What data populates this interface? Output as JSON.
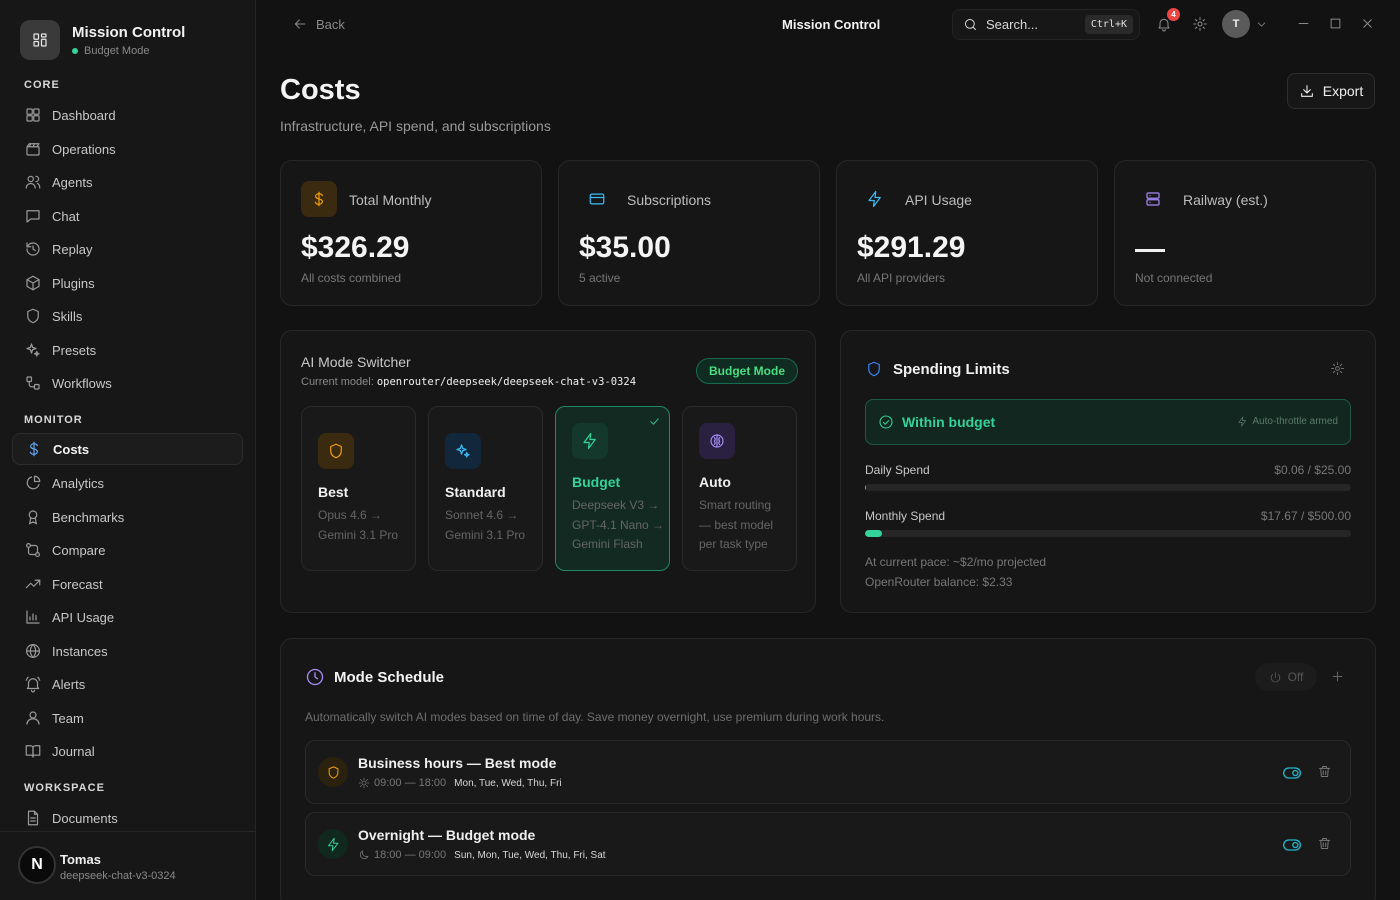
{
  "sidebar": {
    "brand_title": "Mission Control",
    "brand_mode": "Budget Mode",
    "sections": {
      "core": "CORE",
      "monitor": "MONITOR",
      "workspace": "WORKSPACE"
    },
    "core_items": [
      "Dashboard",
      "Operations",
      "Agents",
      "Chat",
      "Replay",
      "Plugins",
      "Skills",
      "Presets",
      "Workflows"
    ],
    "monitor_items": [
      "Costs",
      "Analytics",
      "Benchmarks",
      "Compare",
      "Forecast",
      "API Usage",
      "Instances",
      "Alerts",
      "Team",
      "Journal"
    ],
    "workspace_items": [
      "Documents"
    ],
    "active": "Costs",
    "user": {
      "initial": "N",
      "name": "Tomas",
      "model": "deepseek-chat-v3-0324"
    }
  },
  "topbar": {
    "back": "Back",
    "title": "Mission Control",
    "search_placeholder": "Search...",
    "search_shortcut": "Ctrl+K",
    "notifications": "4",
    "avatar_initial": "T"
  },
  "header": {
    "title": "Costs",
    "subtitle": "Infrastructure, API spend, and subscriptions",
    "export": "Export"
  },
  "stats": [
    {
      "label": "Total Monthly",
      "value": "$326.29",
      "note": "All costs combined",
      "icon": "dollar-icon",
      "color": "#f59e0b"
    },
    {
      "label": "Subscriptions",
      "value": "$35.00",
      "note": "5 active",
      "icon": "credit-card-icon",
      "color": "#38bdf8"
    },
    {
      "label": "API Usage",
      "value": "$291.29",
      "note": "All API providers",
      "icon": "lightning-icon",
      "color": "#38bdf8"
    },
    {
      "label": "Railway (est.)",
      "value": "",
      "note": "Not connected",
      "icon": "server-icon",
      "color": "#a78bfa"
    }
  ],
  "mode_switcher": {
    "title": "AI Mode Switcher",
    "current_label": "Current model:",
    "current_model": "openrouter/deepseek/deepseek-chat-v3-0324",
    "active_pill": "Budget Mode",
    "modes": [
      {
        "name": "Best",
        "desc": "Opus 4.6 → Gemini 3.1 Pro",
        "icon": "shield-icon",
        "color": "#f59e0b"
      },
      {
        "name": "Standard",
        "desc": "Sonnet 4.6 → Gemini 3.1 Pro",
        "icon": "sparkles-icon",
        "color": "#38bdf8"
      },
      {
        "name": "Budget",
        "desc": "Deepseek V3 → GPT-4.1 Nano → Gemini Flash",
        "icon": "lightning-icon",
        "color": "#34d399",
        "selected": true
      },
      {
        "name": "Auto",
        "desc": "Smart routing — best model per task type",
        "icon": "brain-icon",
        "color": "#a78bfa"
      }
    ]
  },
  "spending": {
    "title": "Spending Limits",
    "status": "Within budget",
    "throttle": "Auto-throttle armed",
    "daily": {
      "label": "Daily Spend",
      "value": "$0.06 / $25.00",
      "fraction": 0.0024
    },
    "monthly": {
      "label": "Monthly Spend",
      "value": "$17.67 / $500.00",
      "fraction": 0.0353
    },
    "pace": "At current pace: ~$2/mo projected",
    "balance": "OpenRouter balance: $2.33"
  },
  "schedule": {
    "title": "Mode Schedule",
    "toggle": "Off",
    "description": "Automatically switch AI modes based on time of day. Save money overnight, use premium during work hours.",
    "rows": [
      {
        "name": "Business hours — Best mode",
        "time": "09:00 — 18:00",
        "days": "Mon, Tue, Wed, Thu, Fri",
        "icon": "shield-icon",
        "color": "#f59e0b",
        "time_icon": "sun-icon"
      },
      {
        "name": "Overnight — Budget mode",
        "time": "18:00 — 09:00",
        "days": "Sun, Mon, Tue, Wed, Thu, Fri, Sat",
        "icon": "lightning-icon",
        "color": "#34d399",
        "time_icon": "moon-icon"
      }
    ]
  }
}
